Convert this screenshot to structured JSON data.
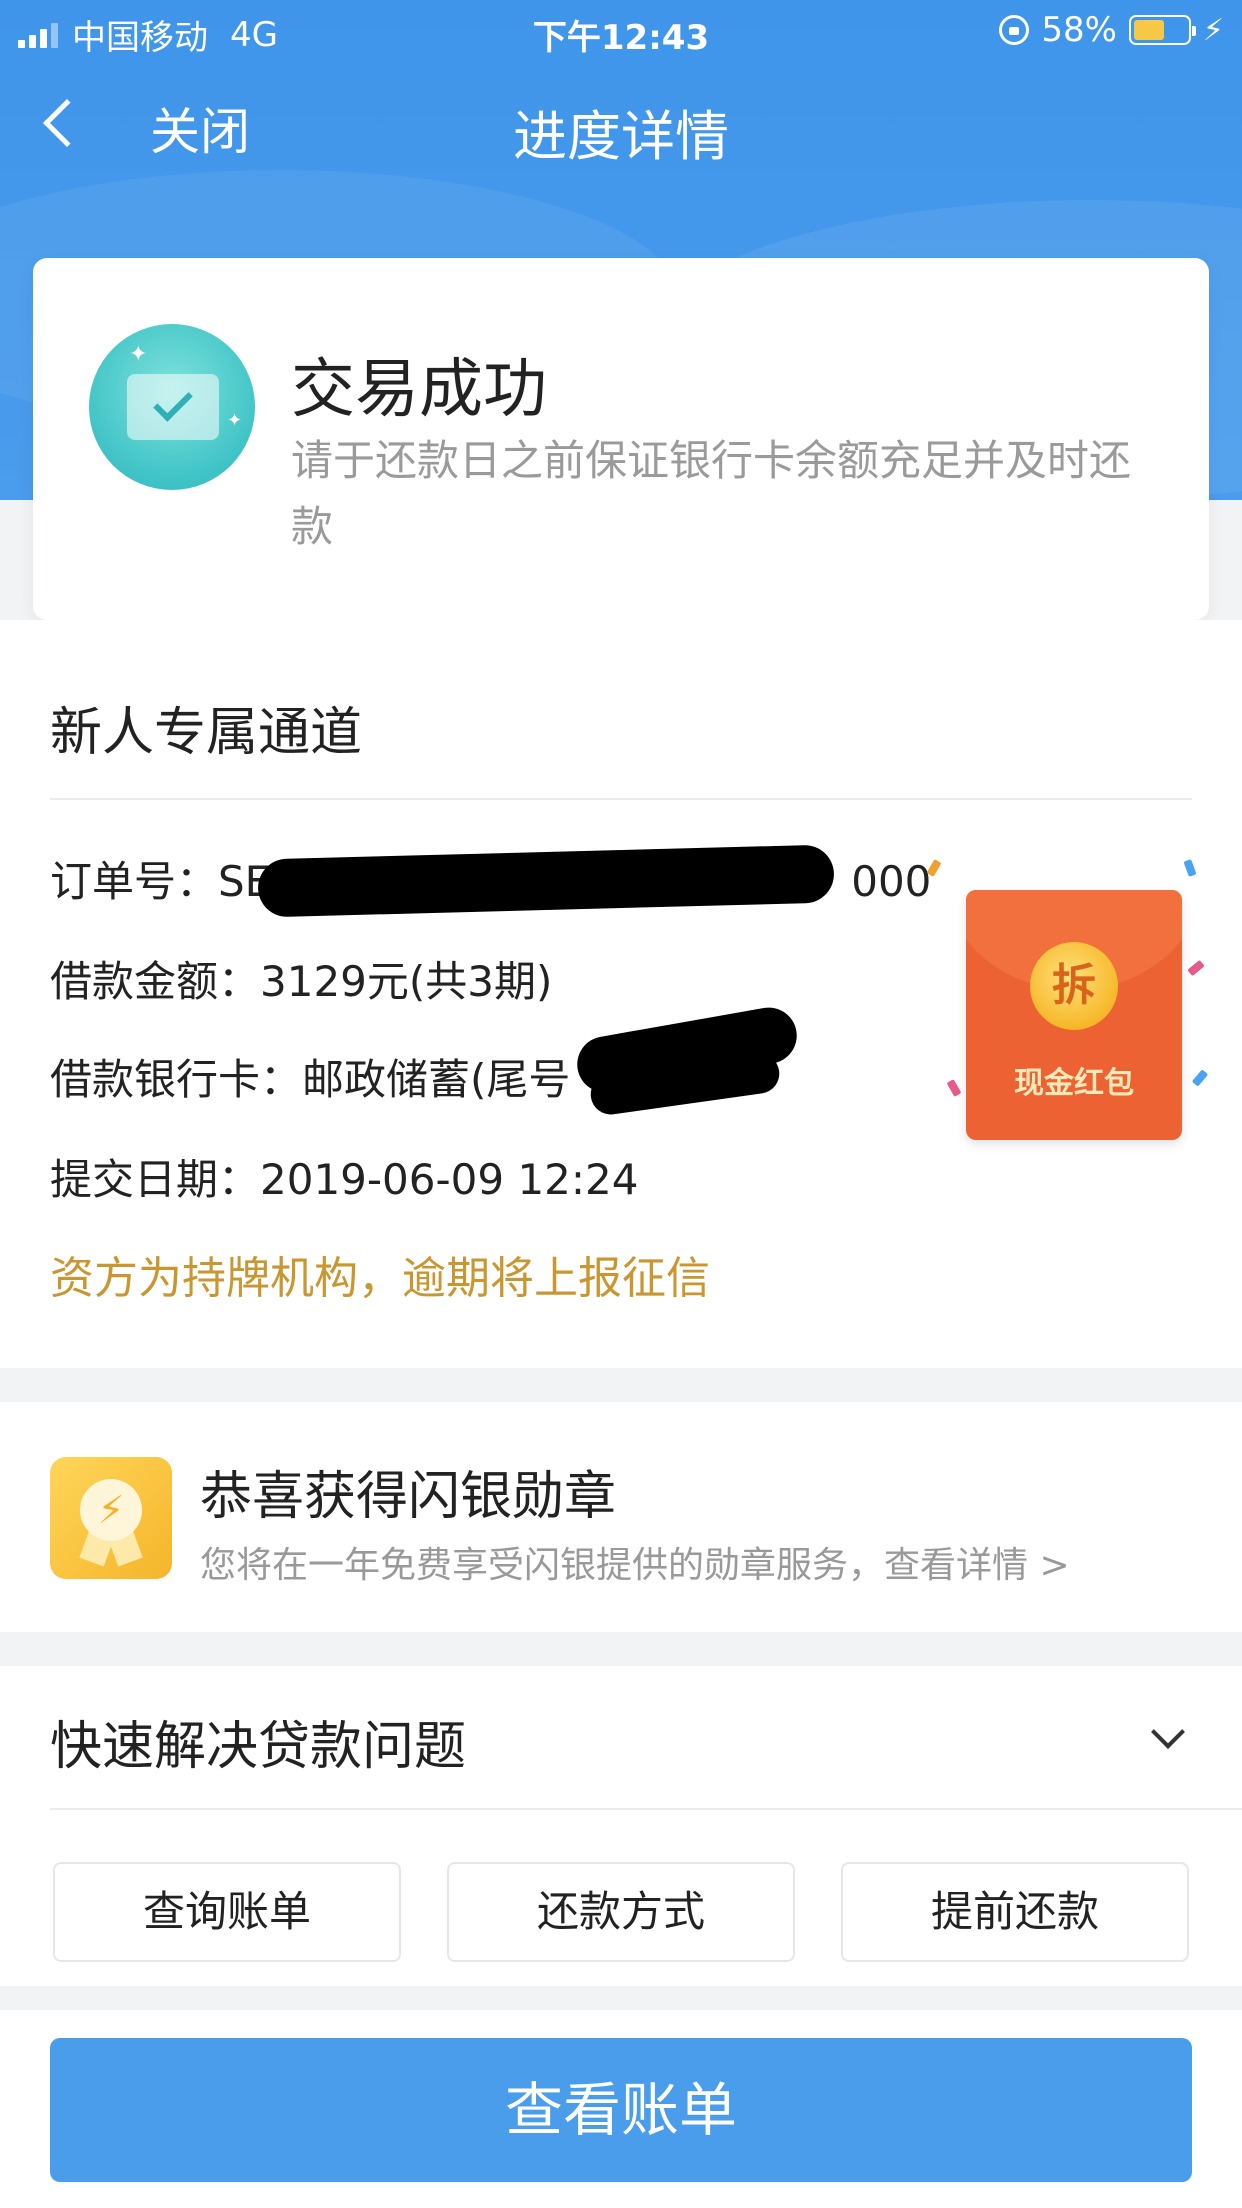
{
  "status_bar": {
    "carrier": "中国移动",
    "network": "4G",
    "time": "下午12:43",
    "battery": "58%",
    "battery_level": 0.58
  },
  "navbar": {
    "close_label": "关闭",
    "title": "进度详情"
  },
  "status_card": {
    "title": "交易成功",
    "description": "请于还款日之前保证银行卡余额充足并及时还款"
  },
  "order": {
    "channel_title": "新人专属通道",
    "order_no_label": "订单号：",
    "order_no_prefix": "SE",
    "order_no_suffix": "000",
    "amount_label": "借款金额：",
    "amount_value": "3129元(共3期)",
    "bank_label": "借款银行卡：",
    "bank_value": "邮政储蓄(尾号",
    "date_label": "提交日期：",
    "date_value": "2019-06-09 12:24",
    "warning": "资方为持牌机构，逾期将上报征信"
  },
  "red_packet": {
    "coin_char": "拆",
    "label": "现金红包"
  },
  "medal": {
    "title": "恭喜获得闪银勋章",
    "description": "您将在一年免费享受闪银提供的勋章服务，查看详情 >"
  },
  "faq": {
    "title": "快速解决贷款问题",
    "buttons": [
      "查询账单",
      "还款方式",
      "提前还款"
    ]
  },
  "bottom": {
    "main_button": "查看账单"
  },
  "colors": {
    "brand_blue": "#4a9deb",
    "warning_gold": "#c9962f",
    "red_packet": "#ec6232"
  }
}
